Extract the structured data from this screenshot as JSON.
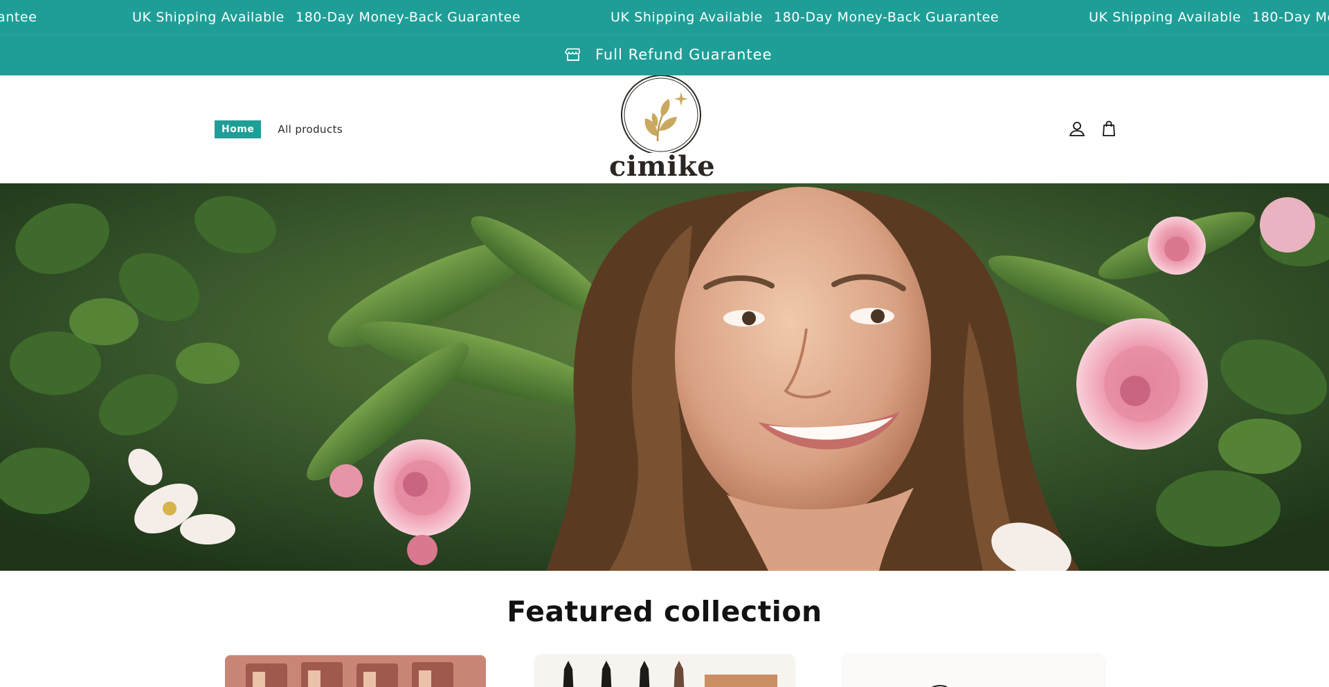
{
  "marquee": {
    "items": [
      "antee",
      "UK Shipping Available",
      "180-Day Money-Back Guarantee",
      "UK Shipping Available",
      "180-Day Money-Back Guarantee",
      "UK Shipping Available",
      "180-Day Mo"
    ]
  },
  "announcement": {
    "icon": "store-icon",
    "text": "Full Refund Guarantee"
  },
  "nav": {
    "home": "Home",
    "all_products": "All products"
  },
  "logo": {
    "wordmark": "cimike"
  },
  "header_icons": [
    "account-icon",
    "cart-icon"
  ],
  "featured": {
    "title": "Featured collection"
  },
  "colors": {
    "accent": "#1f9e97",
    "text": "#121212",
    "logo_gold": "#c9a85f"
  }
}
